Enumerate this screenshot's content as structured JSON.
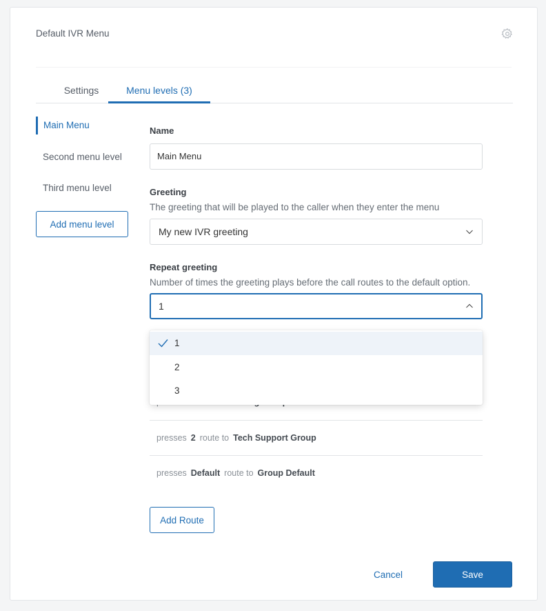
{
  "header": {
    "title": "Default IVR Menu",
    "settings_icon": "gear-icon"
  },
  "tabs": [
    {
      "label": "Settings",
      "active": false
    },
    {
      "label": "Menu levels (3)",
      "active": true
    }
  ],
  "sidebar": {
    "items": [
      {
        "label": "Main Menu",
        "active": true
      },
      {
        "label": "Second menu level",
        "active": false
      },
      {
        "label": "Third menu level",
        "active": false
      }
    ],
    "add_label": "Add menu level"
  },
  "form": {
    "name": {
      "label": "Name",
      "value": "Main Menu"
    },
    "greeting": {
      "label": "Greeting",
      "help": "The greeting that will be played to the caller when they enter the menu",
      "value": "My new IVR greeting"
    },
    "repeat": {
      "label": "Repeat greeting",
      "help": "Number of times the greeting plays before the call routes to the default option.",
      "value": "1",
      "options": [
        "1",
        "2",
        "3"
      ],
      "selected_index": 0
    }
  },
  "routes": [
    {
      "presses": "presses",
      "key": "1",
      "route_to": "route to",
      "target": "Billing Group"
    },
    {
      "presses": "presses",
      "key": "2",
      "route_to": "route to",
      "target": "Tech Support Group"
    },
    {
      "presses": "presses",
      "key": "Default",
      "route_to": "route to",
      "target": "Group Default"
    }
  ],
  "actions": {
    "add_route": "Add Route",
    "cancel": "Cancel",
    "save": "Save"
  },
  "colors": {
    "accent": "#1f6db3",
    "selected_option_bg": "#eef3f9"
  }
}
